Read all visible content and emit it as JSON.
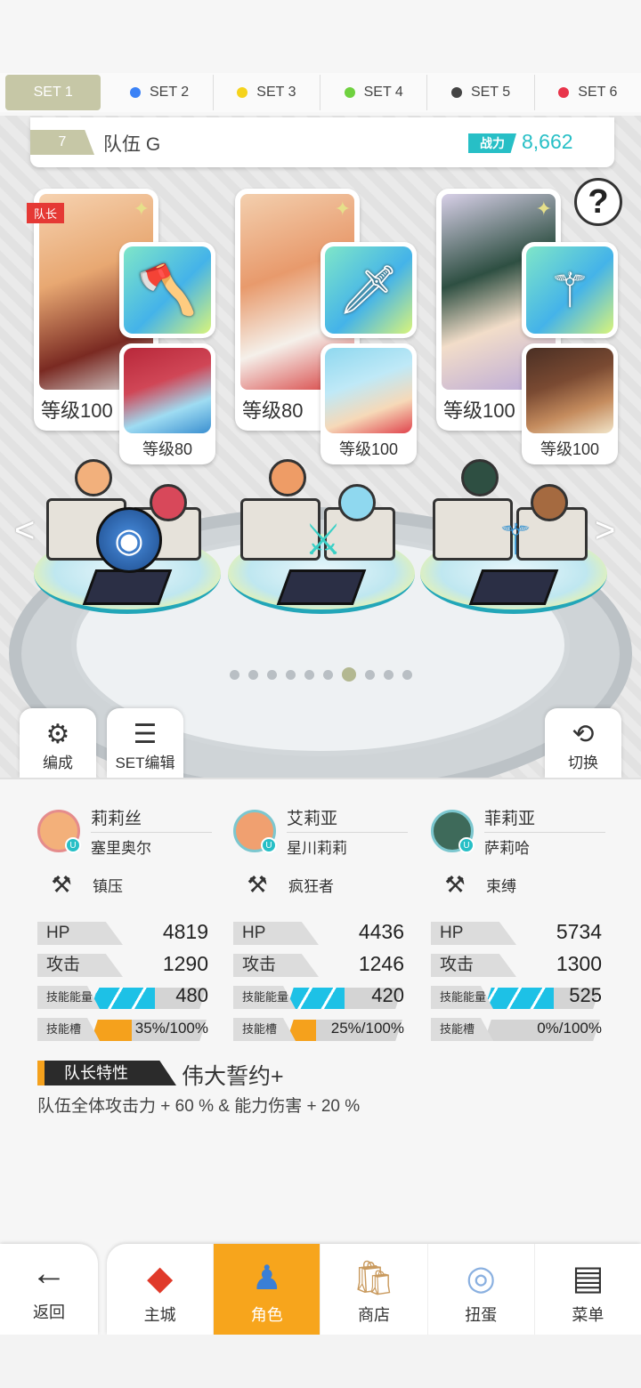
{
  "set_tabs": [
    {
      "label": "SET 1",
      "color": ""
    },
    {
      "label": "SET 2",
      "color": "#3b82f6"
    },
    {
      "label": "SET 3",
      "color": "#f5d31c"
    },
    {
      "label": "SET 4",
      "color": "#6fd13f"
    },
    {
      "label": "SET 5",
      "color": "#444444"
    },
    {
      "label": "SET 6",
      "color": "#e8344a"
    }
  ],
  "team": {
    "number": "7",
    "name": "队伍 G",
    "power_label": "战力",
    "power_value": "8,662"
  },
  "help_label": "?",
  "characters": [
    {
      "leader_tag": "队长",
      "level": "等级100",
      "support_level": "等级80",
      "weapon_icon": "axe-icon"
    },
    {
      "leader_tag": "",
      "level": "等级80",
      "support_level": "等级100",
      "weapon_icon": "sword-icon"
    },
    {
      "leader_tag": "",
      "level": "等级100",
      "support_level": "等级100",
      "weapon_icon": "staff-icon"
    }
  ],
  "pager": {
    "count": 10,
    "active_index": 6
  },
  "actions": {
    "formation": "编成",
    "set_edit": "SET编辑",
    "switch": "切换"
  },
  "members": [
    {
      "name": "莉莉丝",
      "support": "塞里奥尔",
      "skill": "镇压",
      "hp": "4819",
      "atk": "1290",
      "energy": "480",
      "energy_fill": 0.55,
      "slot": "35%/100%",
      "slot_fill": 0.35,
      "avatar_color": "#f3b07a"
    },
    {
      "name": "艾莉亚",
      "support": "星川莉莉",
      "skill": "疯狂者",
      "hp": "4436",
      "atk": "1246",
      "energy": "420",
      "energy_fill": 0.5,
      "slot": "25%/100%",
      "slot_fill": 0.25,
      "avatar_color": "#f0a070"
    },
    {
      "name": "菲莉亚",
      "support": "萨莉哈",
      "skill": "束缚",
      "hp": "5734",
      "atk": "1300",
      "energy": "525",
      "energy_fill": 0.6,
      "slot": "0%/100%",
      "slot_fill": 0.0,
      "avatar_color": "#3e6a5a"
    }
  ],
  "stat_labels": {
    "hp": "HP",
    "atk": "攻击",
    "energy": "技能能量",
    "slot": "技能槽"
  },
  "leader_trait": {
    "label": "队长特性",
    "name": "伟大誓约+",
    "desc": "队伍全体攻击力 + 60 % & 能力伤害 + 20 %"
  },
  "nav": {
    "back": "返回",
    "items": [
      "主城",
      "角色",
      "商店",
      "扭蛋",
      "菜单"
    ],
    "active": "角色"
  },
  "colors": {
    "accent": "#27bfc6",
    "active_tab": "#c6c7a6",
    "nav_active": "#f7a51c",
    "energy": "#1dc1e6",
    "slot": "#f5a11c"
  }
}
